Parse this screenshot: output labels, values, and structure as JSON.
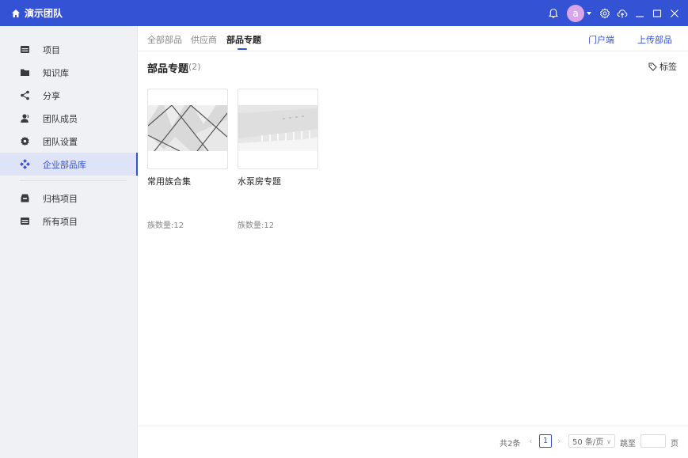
{
  "titlebar": {
    "title": "演示团队",
    "avatar_letter": "a",
    "icons": [
      "home-icon",
      "bell-icon",
      "settings-icon",
      "cloud-upload-icon",
      "minimize-icon",
      "maximize-icon",
      "close-icon"
    ]
  },
  "sidebar": {
    "items": [
      {
        "label": "项目",
        "icon": "project-icon"
      },
      {
        "label": "知识库",
        "icon": "folder-icon"
      },
      {
        "label": "分享",
        "icon": "share-icon"
      },
      {
        "label": "团队成员",
        "icon": "members-icon"
      },
      {
        "label": "团队设置",
        "icon": "gear-icon"
      },
      {
        "label": "企业部品库",
        "icon": "library-icon",
        "active": true
      },
      {
        "label": "归档项目",
        "icon": "archive-icon"
      },
      {
        "label": "所有项目",
        "icon": "all-projects-icon"
      }
    ]
  },
  "tabs": [
    "全部部品",
    "供应商",
    "部品专题"
  ],
  "active_tab": "部品专题",
  "top_links": {
    "portal": "门户端",
    "upload": "上传部品"
  },
  "section": {
    "title": "部品专题",
    "count": "(2)",
    "tag_label": "标签"
  },
  "cards": [
    {
      "name": "常用族合集",
      "meta": "族数量:12"
    },
    {
      "name": "水泵房专题",
      "meta": "族数量:12"
    }
  ],
  "pagination": {
    "total": "共2条",
    "current_page": "1",
    "page_size": "50 条/页",
    "jump_label": "跳至",
    "page_unit": "页"
  },
  "colors": {
    "accent": "#3452d4",
    "sidebar_bg": "#f0f1f5",
    "avatar": "#d8a6e8"
  }
}
